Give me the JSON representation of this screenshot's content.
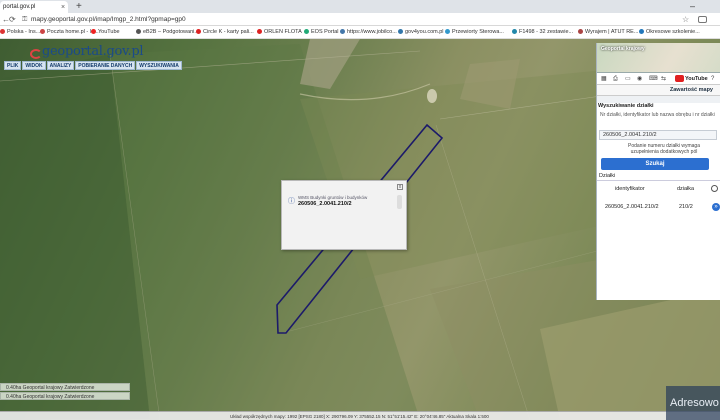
{
  "browser": {
    "tab_title": "portal.gov.pl",
    "tab_close": "×",
    "new_tab": "+",
    "minimize": "–",
    "url": "mapy.geoportal.gov.pl/imap/Imgp_2.html?gpmap=gp0",
    "back": "←",
    "forward": "→",
    "reload": "⟳",
    "star": "☆",
    "bookmarks": [
      {
        "label": "Polska - Ins...",
        "color": "#d33"
      },
      {
        "label": "Poczta home.pl - lo...",
        "color": "#c44"
      },
      {
        "label": "YouTube",
        "color": "#e22"
      },
      {
        "label": "eB2B – Podgotowani...",
        "color": "#555"
      },
      {
        "label": "Circle K - karty pali...",
        "color": "#d22"
      },
      {
        "label": "ORLEN FLOTA",
        "color": "#d22"
      },
      {
        "label": "EOS Portal",
        "color": "#2a7"
      },
      {
        "label": "https://www.jobilco...",
        "color": "#47a"
      },
      {
        "label": "gov4you.com.pl",
        "color": "#37a"
      },
      {
        "label": "Przewiorty Sterowa...",
        "color": "#39c"
      },
      {
        "label": "F1498 - 32 zestawie...",
        "color": "#28a"
      },
      {
        "label": "Wyrajem | ATUT RE...",
        "color": "#a44"
      },
      {
        "label": "Okresowe szkolenie...",
        "color": "#27b"
      }
    ]
  },
  "logo": {
    "text": "geoportal.gov.pl"
  },
  "menu": [
    "PLIK",
    "WIDOK",
    "ANALIZY",
    "POBIERANIE DANYCH",
    "WYSZUKIWANIA"
  ],
  "popup": {
    "title": "WMS Budynki gruntów i budynków",
    "value": "260506_2.0041.210/2",
    "close": "x",
    "info": "ⓘ"
  },
  "layers": [
    "0.40ha   Geoportal krajowy   Zatwierdzone",
    "0.40ha   Geoportal krajowy   Zatwierdzone"
  ],
  "statusbar": "Układ współrzędnych mapy:  1992 [EPSG 2180]    X: 290796.09  Y: 375552.15    N: 51°51'15.42\"  E: 20°04'46.85\"    Aktualna Skala 1:500",
  "panel": {
    "minimap_title": "Geoportal krajowy",
    "youtube": "YouTube",
    "zawartosc": "Zawartość mapy",
    "search_title": "Wyszukiwanie działki",
    "search_hint": "Nr działki, identyfikator lub nazwa obrębu i nr działki",
    "search_value": "260506_2.0041.210/2",
    "search_note": "Podanie numeru działki wymaga uzupełnienia dodatkowych pól",
    "search_button": "Szukaj",
    "dzialki_label": "Działki",
    "col_identyfikator": "identyfikator",
    "col_dzialka": "działka",
    "row_identyfikator": "260506_2.0041.210/2",
    "row_dzialka": "210/2",
    "row_action": "»"
  },
  "watermark": "Adresowo"
}
